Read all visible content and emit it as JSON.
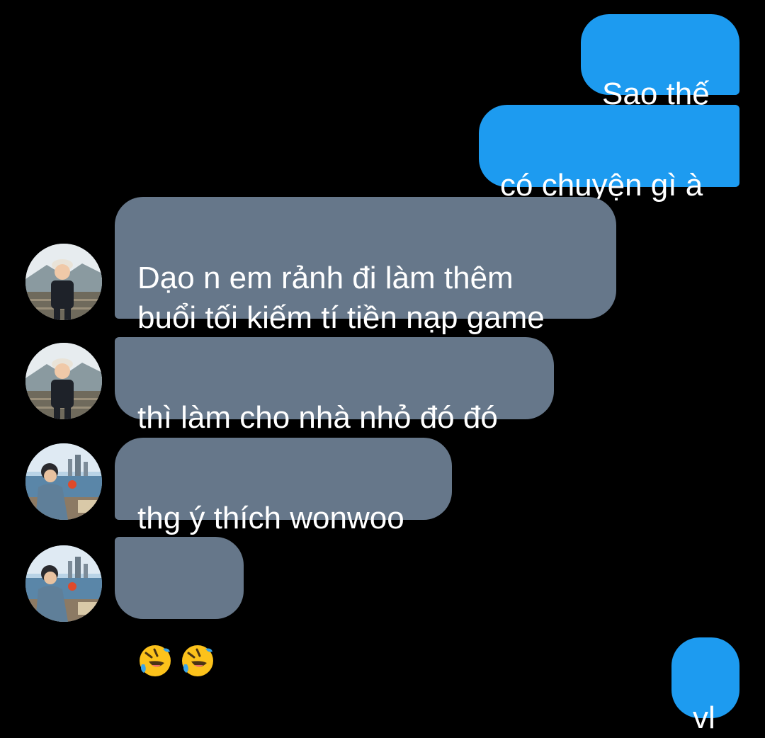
{
  "messages": {
    "out_1": "Sao thế",
    "out_2": "có chuyện gì à",
    "in_1": "Dạo n em rảnh đi làm thêm\nbuổi tối kiếm tí tiền nạp game",
    "in_2": "thì làm cho nhà nhỏ đó đó",
    "in_3": "thg ý thích wonwoo",
    "in_4_emoji": [
      "rolling-on-the-floor-laughing",
      "rolling-on-the-floor-laughing"
    ],
    "out_3": "vl"
  },
  "colors": {
    "background": "#000000",
    "outgoing_bubble": "#1d9bf0",
    "incoming_bubble": "#66778a",
    "text": "#ffffff"
  }
}
